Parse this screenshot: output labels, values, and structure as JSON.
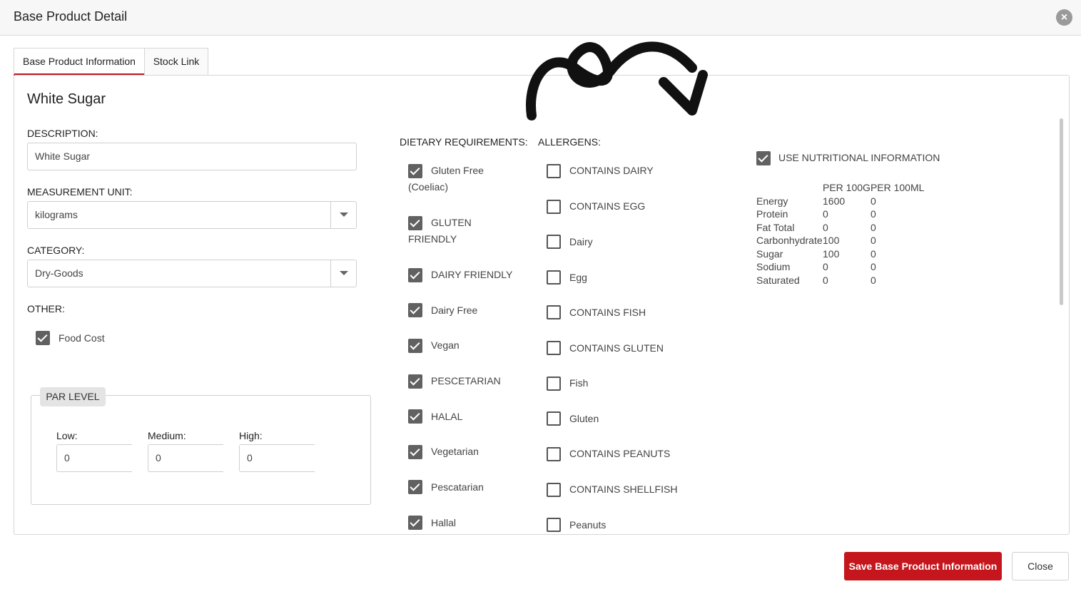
{
  "window": {
    "title": "Base Product Detail"
  },
  "tabs": [
    {
      "label": "Base Product Information",
      "active": true
    },
    {
      "label": "Stock Link",
      "active": false
    }
  ],
  "product": {
    "name": "White Sugar"
  },
  "form": {
    "description_label": "DESCRIPTION:",
    "description_value": "White Sugar",
    "measurement_label": "MEASUREMENT UNIT:",
    "measurement_value": "kilograms",
    "category_label": "CATEGORY:",
    "category_value": "Dry-Goods",
    "other_label": "OTHER:",
    "food_cost_label": "Food Cost",
    "food_cost_checked": true
  },
  "par_level": {
    "title": "PAR LEVEL",
    "low_label": "Low:",
    "low_value": "0",
    "medium_label": "Medium:",
    "medium_value": "0",
    "high_label": "High:",
    "high_value": "0"
  },
  "dietary": {
    "title": "DIETARY REQUIREMENTS:",
    "items": [
      {
        "line1": "Gluten Free",
        "line2": "(Coeliac)",
        "checked": true
      },
      {
        "line1": "GLUTEN",
        "line2": "FRIENDLY",
        "checked": true
      },
      {
        "line1": "DAIRY FRIENDLY",
        "line2": "",
        "checked": true
      },
      {
        "line1": "Dairy Free",
        "line2": "",
        "checked": true
      },
      {
        "line1": "Vegan",
        "line2": "",
        "checked": true
      },
      {
        "line1": "PESCETARIAN",
        "line2": "",
        "checked": true
      },
      {
        "line1": "HALAL",
        "line2": "",
        "checked": true
      },
      {
        "line1": "Vegetarian",
        "line2": "",
        "checked": true
      },
      {
        "line1": "Pescatarian",
        "line2": "",
        "checked": true
      },
      {
        "line1": "Hallal",
        "line2": "",
        "checked": true
      }
    ]
  },
  "allergens": {
    "title": "ALLERGENS:",
    "items": [
      {
        "label": "CONTAINS DAIRY",
        "checked": false
      },
      {
        "label": "CONTAINS EGG",
        "checked": false
      },
      {
        "label": "Dairy",
        "checked": false
      },
      {
        "label": "Egg",
        "checked": false
      },
      {
        "label": "CONTAINS FISH",
        "checked": false
      },
      {
        "label": "CONTAINS GLUTEN",
        "checked": false
      },
      {
        "label": "Fish",
        "checked": false
      },
      {
        "label": "Gluten",
        "checked": false
      },
      {
        "label": "CONTAINS PEANUTS",
        "checked": false
      },
      {
        "label": "CONTAINS SHELLFISH",
        "checked": false
      },
      {
        "label": "Peanuts",
        "checked": false
      }
    ]
  },
  "nutrition": {
    "use_label": "USE NUTRITIONAL INFORMATION",
    "use_checked": true,
    "headers": [
      "",
      "PER 100G",
      "PER 100ML"
    ],
    "rows": [
      [
        "Energy",
        "1600",
        "0"
      ],
      [
        "Protein",
        "0",
        "0"
      ],
      [
        "Fat Total",
        "0",
        "0"
      ],
      [
        "Carbonhydrate",
        "100",
        "0"
      ],
      [
        "Sugar",
        "100",
        "0"
      ],
      [
        "Sodium",
        "0",
        "0"
      ],
      [
        "Saturated",
        "0",
        "0"
      ]
    ]
  },
  "footer": {
    "save_label": "Save Base Product Information",
    "close_label": "Close"
  },
  "colors": {
    "accent": "#c4161c",
    "checkbox": "#616161"
  }
}
